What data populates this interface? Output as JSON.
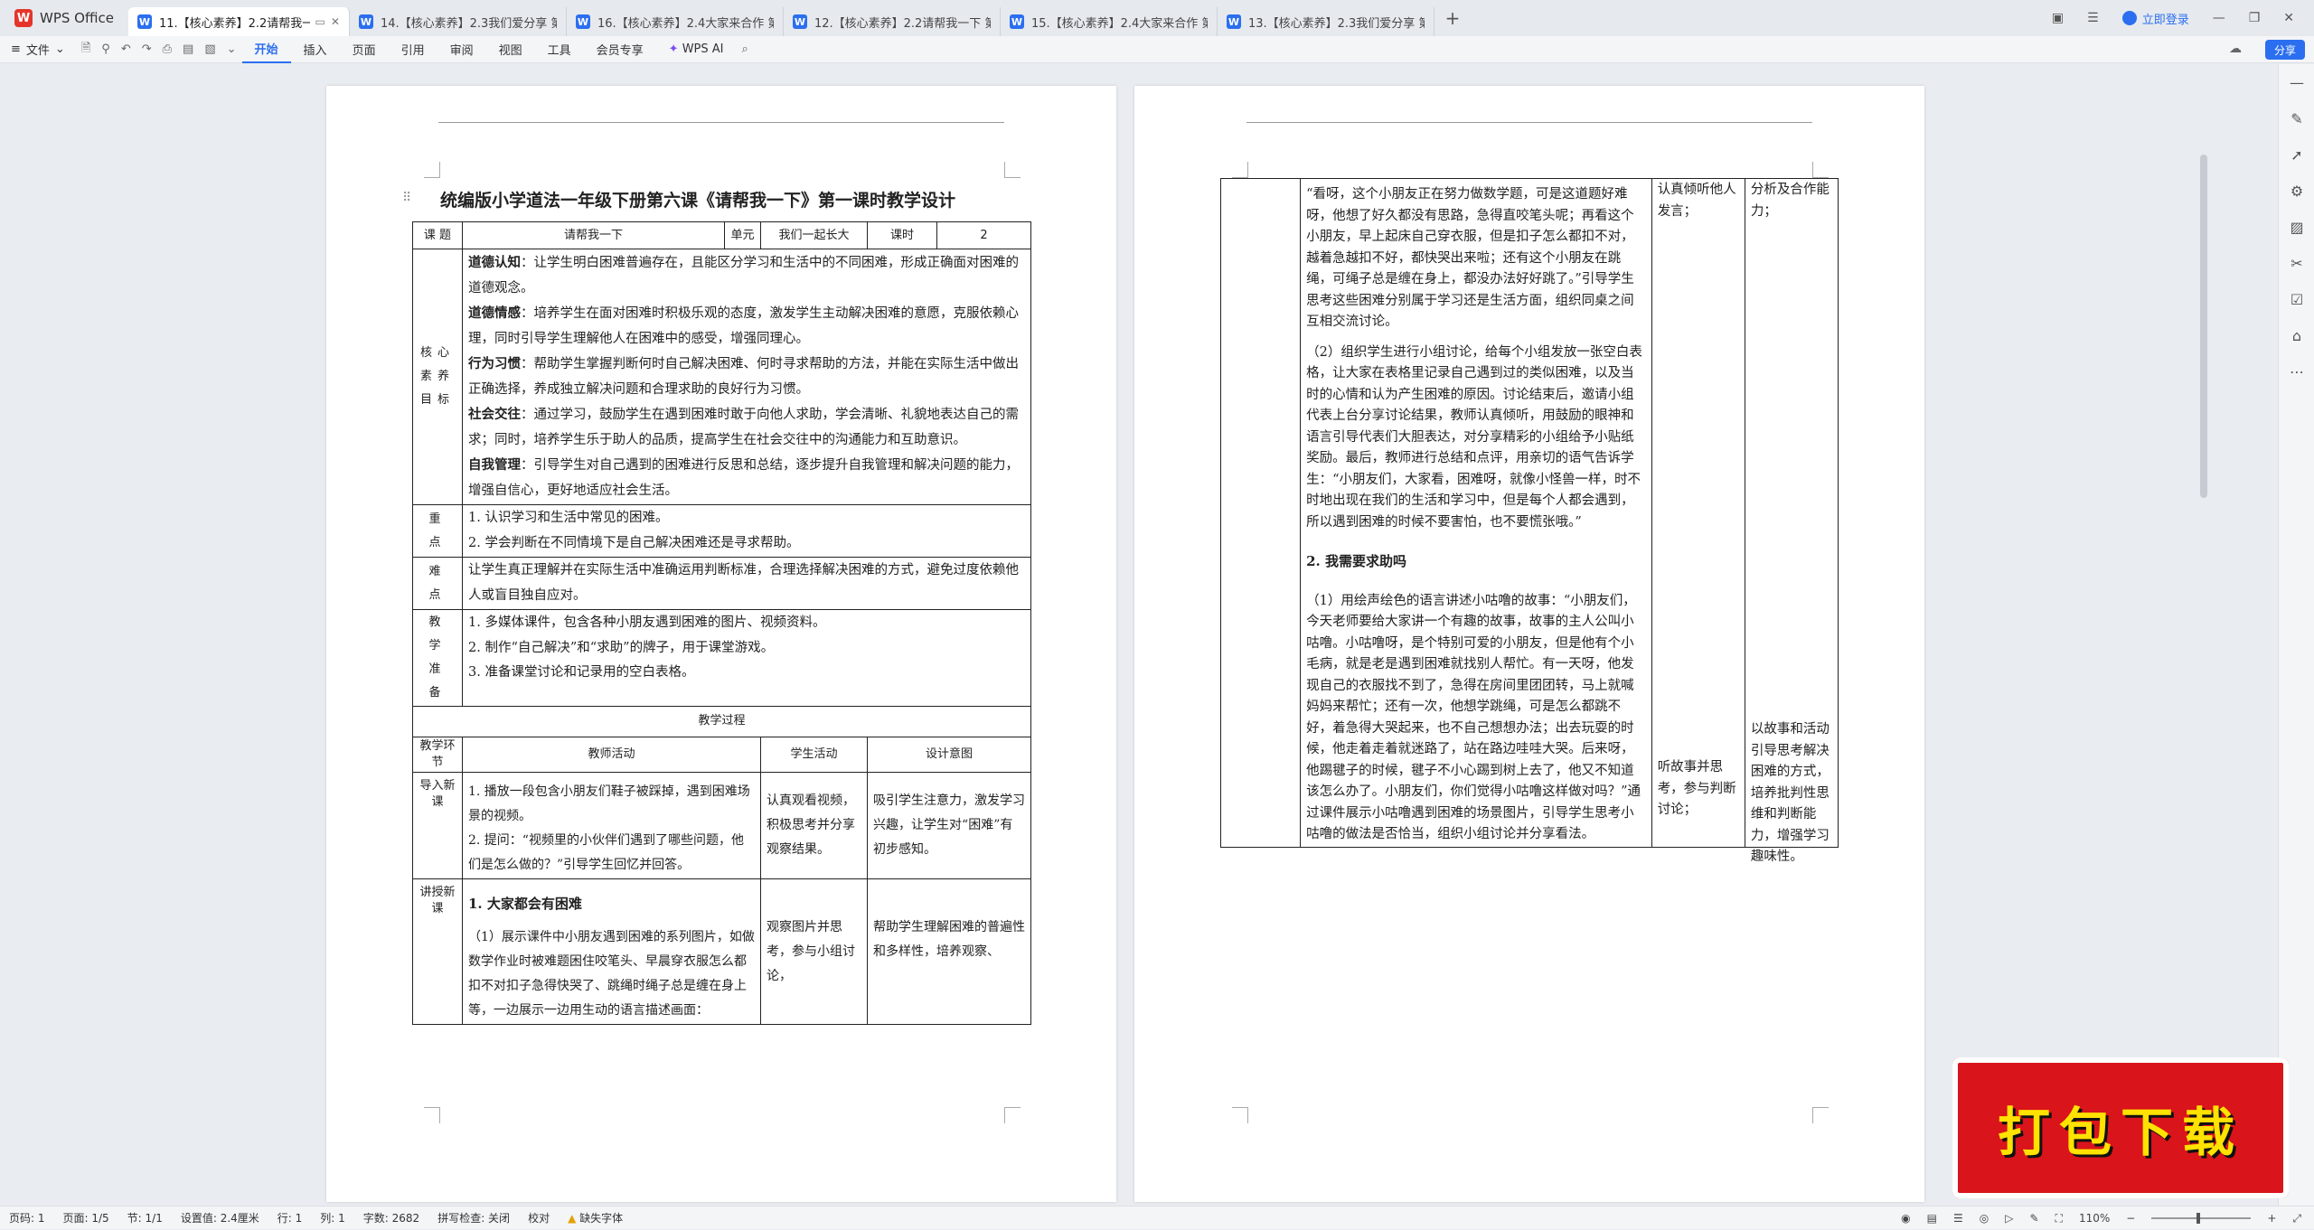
{
  "app": {
    "name": "WPS Office",
    "login": "立即登录",
    "share": "分享"
  },
  "tabs": [
    {
      "label": "11.【核心素养】2.2请帮我一"
    },
    {
      "label": "14.【核心素养】2.3我们爱分享 第2课"
    },
    {
      "label": "16.【核心素养】2.4大家来合作 第2课"
    },
    {
      "label": "12.【核心素养】2.2请帮我一下 第2课"
    },
    {
      "label": "15.【核心素养】2.4大家来合作 第1课"
    },
    {
      "label": "13.【核心素养】2.3我们爱分享 第1课"
    }
  ],
  "ribbon": {
    "file": "文件",
    "menus": [
      "开始",
      "插入",
      "页面",
      "引用",
      "审阅",
      "视图",
      "工具",
      "会员专享"
    ],
    "ai": "WPS AI"
  },
  "doc": {
    "title": "统编版小学道法一年级下册第六课《请帮我一下》第一课时教学设计",
    "info": {
      "k1": "课 题",
      "v1": "请帮我一下",
      "k2": "单元",
      "v2": "我们一起长大",
      "k3": "课时",
      "v3": "2"
    },
    "goals_label": "核心素养目标",
    "goals": [
      {
        "head": "道德认知",
        "text": "：让学生明白困难普遍存在，且能区分学习和生活中的不同困难，形成正确面对困难的道德观念。"
      },
      {
        "head": "道德情感",
        "text": "：培养学生在面对困难时积极乐观的态度，激发学生主动解决困难的意愿，克服依赖心理，同时引导学生理解他人在困难中的感受，增强同理心。"
      },
      {
        "head": "行为习惯",
        "text": "：帮助学生掌握判断何时自己解决困难、何时寻求帮助的方法，并能在实际生活中做出正确选择，养成独立解决问题和合理求助的良好行为习惯。"
      },
      {
        "head": "社会交往",
        "text": "：通过学习，鼓励学生在遇到困难时敢于向他人求助，学会清晰、礼貌地表达自己的需求；同时，培养学生乐于助人的品质，提高学生在社会交往中的沟通能力和互助意识。"
      },
      {
        "head": "自我管理",
        "text": "：引导学生对自己遇到的困难进行反思和总结，逐步提升自我管理和解决问题的能力，增强自信心，更好地适应社会生活。"
      }
    ],
    "key_label": "重 点",
    "key_points": [
      "1. 认识学习和生活中常见的困难。",
      "2. 学会判断在不同情境下是自己解决困难还是寻求帮助。"
    ],
    "diff_label": "难 点",
    "difficulty": "让学生真正理解并在实际生活中准确运用判断标准，合理选择解决困难的方式，避免过度依赖他人或盲目独自应对。",
    "prep_label": "教 学 准 备",
    "prep": [
      "1. 多媒体课件，包含各种小朋友遇到困难的图片、视频资料。",
      "2. 制作“自己解决”和“求助”的牌子，用于课堂游戏。",
      "3. 准备课堂讨论和记录用的空白表格。"
    ],
    "process_title": "教学过程",
    "cols": [
      "教学环节",
      "教师活动",
      "学生活动",
      "设计意图"
    ],
    "rows": [
      {
        "stage": "导入新课",
        "teacher": [
          "1. 播放一段包含小朋友们鞋子被踩掉，遇到困难场景的视频。",
          "2. 提问：“视频里的小伙伴们遇到了哪些问题，他们是怎么做的？”引导学生回忆并回答。"
        ],
        "student": "认真观看视频，积极思考并分享观察结果。",
        "intent": "吸引学生注意力，激发学习兴趣，让学生对“困难”有初步感知。"
      },
      {
        "stage": "讲授新课",
        "teacher_title": "1. 大家都会有困难",
        "teacher": [
          "（1）展示课件中小朋友遇到困难的系列图片，如做数学作业时被难题困住咬笔头、早晨穿衣服怎么都扣不对扣子急得快哭了、跳绳时绳子总是缠在身上等，一边展示一边用生动的语言描述画面："
        ],
        "student": "观察图片并思考，参与小组讨论，",
        "intent": "帮助学生理解困难的普遍性和多样性，培养观察、"
      }
    ],
    "page2": {
      "teacher_a": "“看呀，这个小朋友正在努力做数学题，可是这道题好难呀，他想了好久都没有思路，急得直咬笔头呢；再看这个小朋友，早上起床自己穿衣服，但是扣子怎么都扣不对，越着急越扣不好，都快哭出来啦；还有这个小朋友在跳绳，可绳子总是缠在身上，都没办法好好跳了。”引导学生思考这些困难分别属于学习还是生活方面，组织同桌之间互相交流讨论。",
      "teacher_b": "（2）组织学生进行小组讨论，给每个小组发放一张空白表格，让大家在表格里记录自己遇到过的类似困难，以及当时的心情和认为产生困难的原因。讨论结束后，邀请小组代表上台分享讨论结果，教师认真倾听，用鼓励的眼神和语言引导代表们大胆表达，对分享精彩的小组给予小贴纸奖励。最后，教师进行总结和点评，用亲切的语气告诉学生：“小朋友们，大家看，困难呀，就像小怪兽一样，时不时地出现在我们的生活和学习中，但是每个人都会遇到，所以遇到困难的时候不要害怕，也不要慌张哦。”",
      "section2": "2. 我需要求助吗",
      "teacher_c": "（1）用绘声绘色的语言讲述小咕噜的故事：“小朋友们，今天老师要给大家讲一个有趣的故事，故事的主人公叫小咕噜。小咕噜呀，是个特别可爱的小朋友，但是他有个小毛病，就是老是遇到困难就找别人帮忙。有一天呀，他发现自己的衣服找不到了，急得在房间里团团转，马上就喊妈妈来帮忙；还有一次，他想学跳绳，可是怎么都跳不好，着急得大哭起来，也不自己想想办法；出去玩耍的时候，他走着走着就迷路了，站在路边哇哇大哭。后来呀，他踢毽子的时候，毽子不小心踢到树上去了，他又不知道该怎么办了。小朋友们，你们觉得小咕噜这样做对吗？”通过课件展示小咕噜遇到困难的场景图片，引导学生思考小咕噜的做法是否恰当，组织小组讨论并分享看法。",
      "student_a": "认真倾听他人发言；",
      "intent_a": "分析及合作能力；",
      "student_c": "听故事并思考，参与判断讨论；",
      "intent_c": "以故事和活动引导思考解决困难的方式，培养批判性思维和判断能力，增强学习趣味性。"
    }
  },
  "status": {
    "page": "页码: 1",
    "pages": "页面: 1/5",
    "section": "节: 1/1",
    "setting": "设置值: 2.4厘米",
    "row": "行: 1",
    "col": "列: 1",
    "words": "字数: 2682",
    "spell": "拼写检查: 关闭",
    "proof": "校对",
    "missing_font": "缺失字体",
    "zoom": "110%"
  },
  "banner": "打包下载"
}
